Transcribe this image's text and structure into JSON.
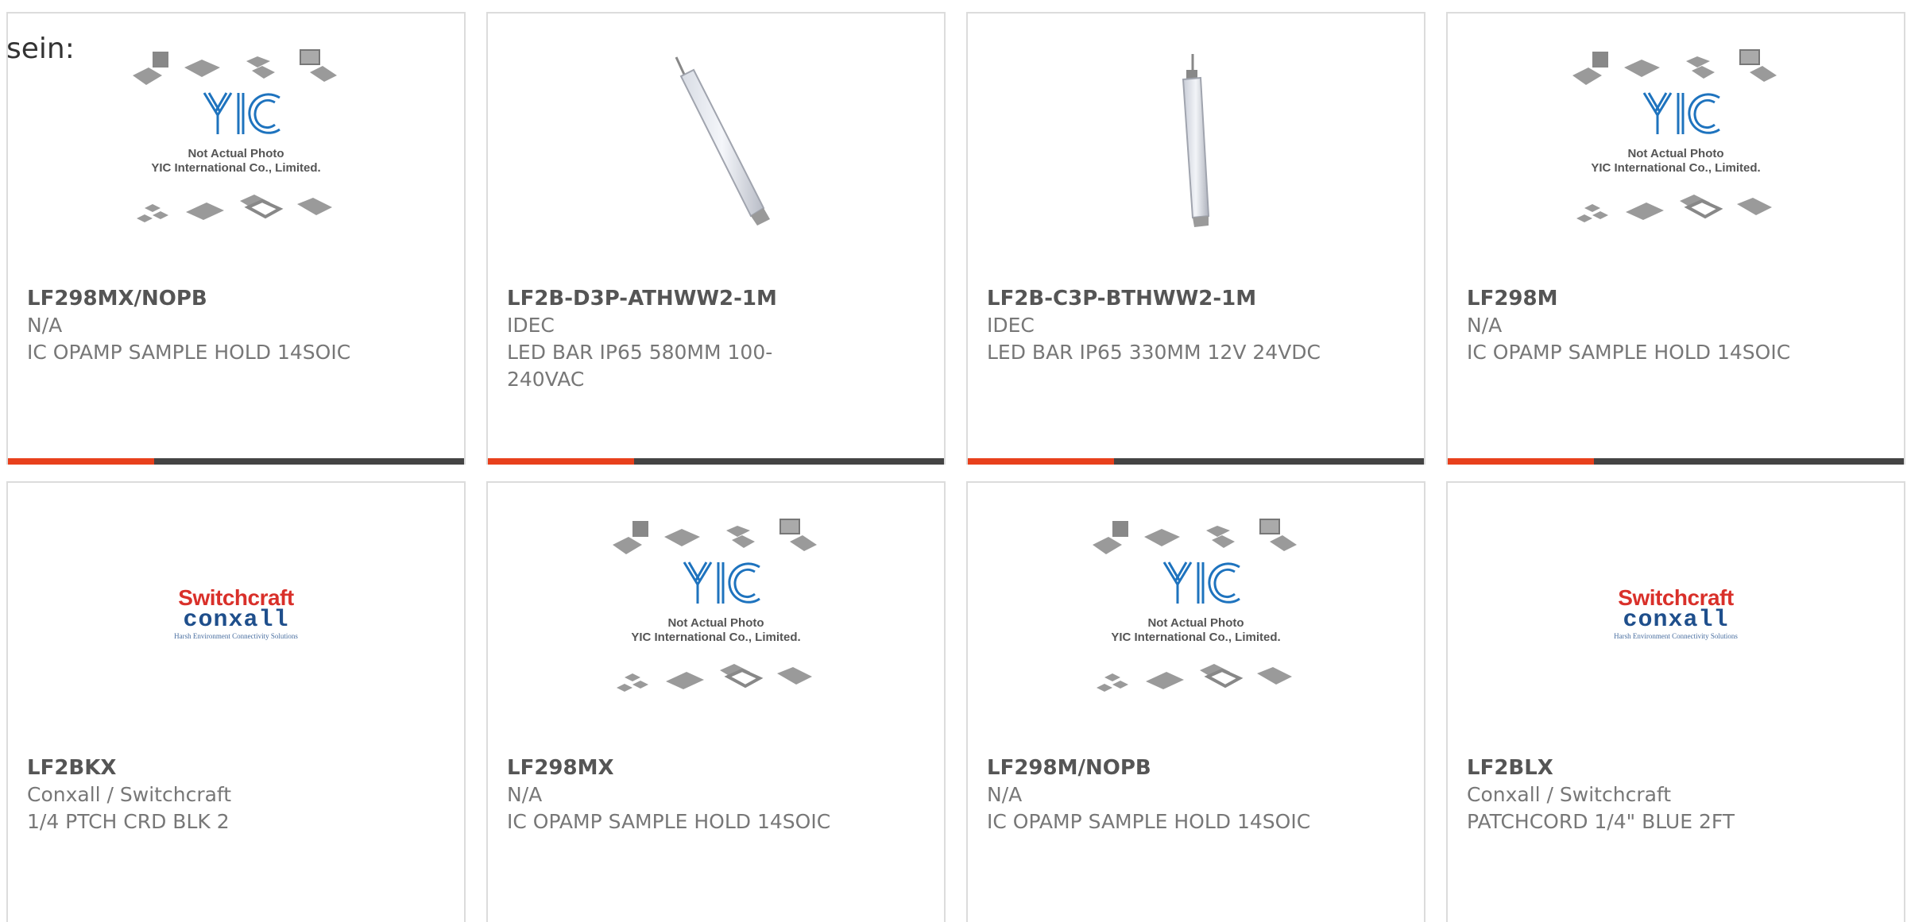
{
  "stray_text": "sein:",
  "placeholder_caption": {
    "line1": "Not Actual Photo",
    "line2": "YIC International Co., Limited."
  },
  "logo_text": {
    "switchcraft": "Switchcraft",
    "conxall": "conxall",
    "tagline": "Harsh Environment Connectivity Solutions"
  },
  "accent_color": "#e8401c",
  "bar_color": "#444444",
  "products": [
    {
      "part_number": "LF298MX/NOPB",
      "manufacturer": "N/A",
      "description": "IC OPAMP SAMPLE HOLD 14SOIC",
      "image": "yic-placeholder"
    },
    {
      "part_number": "LF2B-D3P-ATHWW2-1M",
      "manufacturer": "IDEC",
      "description": "LED BAR IP65 580MM 100-240VAC",
      "image": "led-bar-photo"
    },
    {
      "part_number": "LF2B-C3P-BTHWW2-1M",
      "manufacturer": "IDEC",
      "description": "LED BAR IP65 330MM 12V 24VDC",
      "image": "led-bar-photo"
    },
    {
      "part_number": "LF298M",
      "manufacturer": "N/A",
      "description": "IC OPAMP SAMPLE HOLD 14SOIC",
      "image": "yic-placeholder"
    },
    {
      "part_number": "LF2BKX",
      "manufacturer": "Conxall / Switchcraft",
      "description": "1/4 PTCH CRD BLK 2",
      "image": "switchcraft-logo"
    },
    {
      "part_number": "LF298MX",
      "manufacturer": "N/A",
      "description": "IC OPAMP SAMPLE HOLD 14SOIC",
      "image": "yic-placeholder"
    },
    {
      "part_number": "LF298M/NOPB",
      "manufacturer": "N/A",
      "description": "IC OPAMP SAMPLE HOLD 14SOIC",
      "image": "yic-placeholder"
    },
    {
      "part_number": "LF2BLX",
      "manufacturer": "Conxall / Switchcraft",
      "description": "PATCHCORD 1/4\" BLUE 2FT",
      "image": "switchcraft-logo"
    }
  ]
}
